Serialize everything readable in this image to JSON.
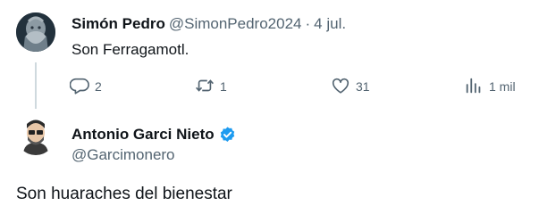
{
  "parent_tweet": {
    "name": "Simón Pedro",
    "handle": "@SimonPedro2024",
    "dot": "·",
    "time": "4 jul.",
    "text": "Son Ferragamotl.",
    "actions": {
      "reply_icon": "reply-icon",
      "reply_count": "2",
      "retweet_icon": "retweet-icon",
      "retweet_count": "1",
      "like_icon": "heart-icon",
      "like_count": "31",
      "views_icon": "analytics-icon",
      "views_count": "1 mil"
    }
  },
  "reply_tweet": {
    "name": "Antonio Garci Nieto",
    "verified_icon": "verified-badge-icon",
    "handle": "@Garcimonero",
    "text": "Son huaraches del bienestar"
  },
  "colors": {
    "text_primary": "#0f1419",
    "text_secondary": "#536471",
    "verified_blue": "#1d9bf0",
    "thread_line": "#cfd9de"
  }
}
